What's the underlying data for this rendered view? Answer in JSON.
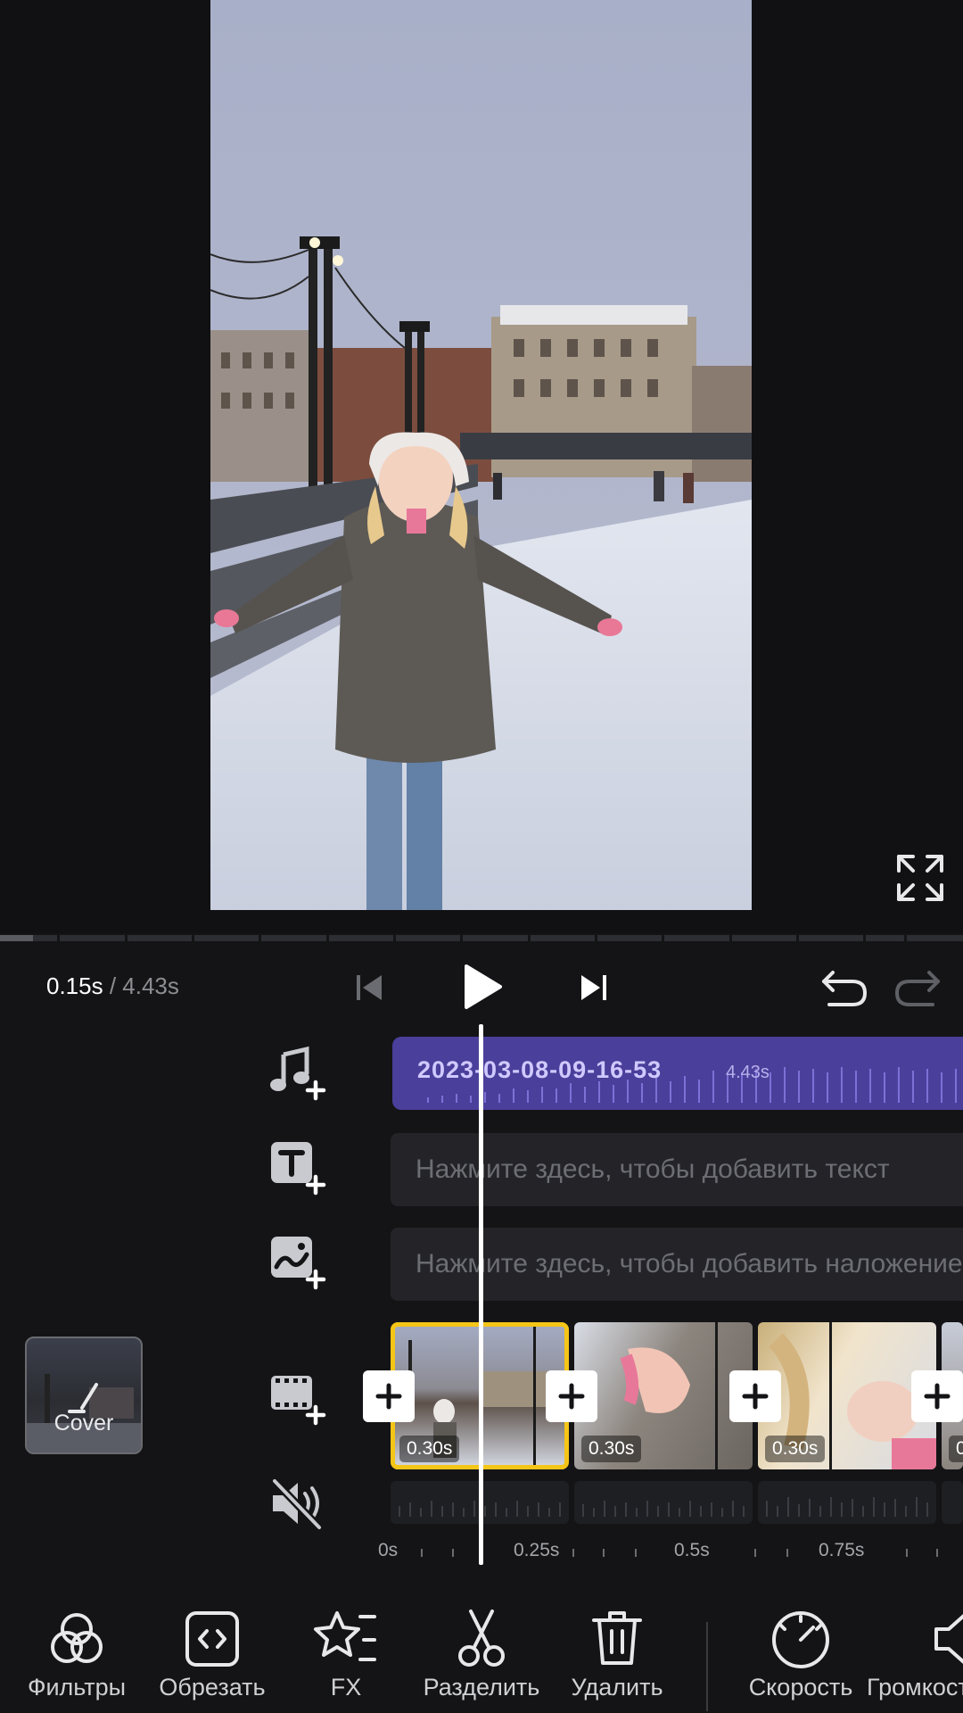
{
  "player": {
    "current_time": "0.15s",
    "separator": " / ",
    "total_time": "4.43s",
    "progress_fraction": 0.034
  },
  "audio_track": {
    "name": "2023-03-08-09-16-53",
    "duration": "4.43s"
  },
  "text_track": {
    "hint": "Нажмите здесь, чтобы добавить текст"
  },
  "overlay_track": {
    "hint": "Нажмите здесь, чтобы добавить наложение"
  },
  "video_track": {
    "clips": [
      {
        "duration": "0.30s",
        "selected": true
      },
      {
        "duration": "0.30s",
        "selected": false
      },
      {
        "duration": "0.30s",
        "selected": false
      },
      {
        "duration": "0",
        "selected": false
      }
    ]
  },
  "cover": {
    "label": "Cover"
  },
  "ruler": {
    "labels": [
      "0s",
      "0.25s",
      "0.5s",
      "0.75s"
    ]
  },
  "toolbar": {
    "items": [
      {
        "label": "Фильтры",
        "icon": "filters-icon"
      },
      {
        "label": "Обрезать",
        "icon": "trim-icon"
      },
      {
        "label": "FX",
        "icon": "fx-star-icon"
      },
      {
        "label": "Разделить",
        "icon": "scissors-icon"
      },
      {
        "label": "Удалить",
        "icon": "trash-icon"
      },
      {
        "label": "Скорость",
        "icon": "speedometer-icon"
      },
      {
        "label": "Громкость",
        "icon": "volume-icon"
      }
    ]
  },
  "colors": {
    "background": "#141416",
    "audio_track": "#4a3f9a",
    "selection": "#f5c518",
    "playhead": "#ffffff"
  }
}
